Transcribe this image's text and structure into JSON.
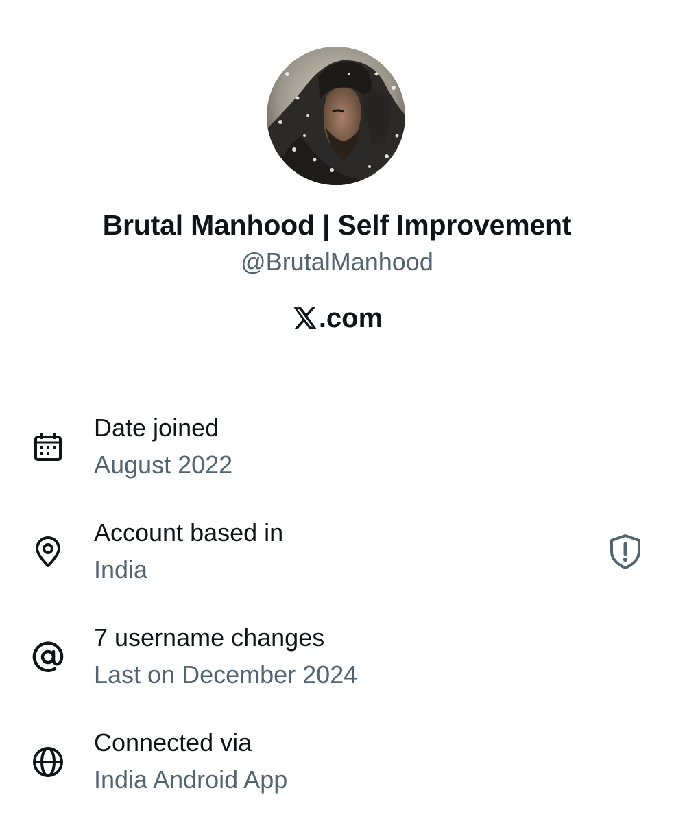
{
  "profile": {
    "avatar_label": "Profile photo of a bearded man wrapped in a dark scarf in the snow",
    "display_name": "Brutal Manhood | Self Improvement",
    "handle": "@BrutalManhood",
    "brand": ".com"
  },
  "details": [
    {
      "icon": "calendar-icon",
      "title": "Date joined",
      "subtitle": "August 2022"
    },
    {
      "icon": "location-pin-icon",
      "title": "Account based in",
      "subtitle": "India"
    },
    {
      "icon": "at-sign-icon",
      "title": "7 username changes",
      "subtitle": "Last on December 2024"
    },
    {
      "icon": "globe-icon",
      "title": "Connected via",
      "subtitle": "India Android App"
    }
  ],
  "colors": {
    "text_primary": "#0f1419",
    "text_secondary": "#536471",
    "background": "#ffffff"
  }
}
